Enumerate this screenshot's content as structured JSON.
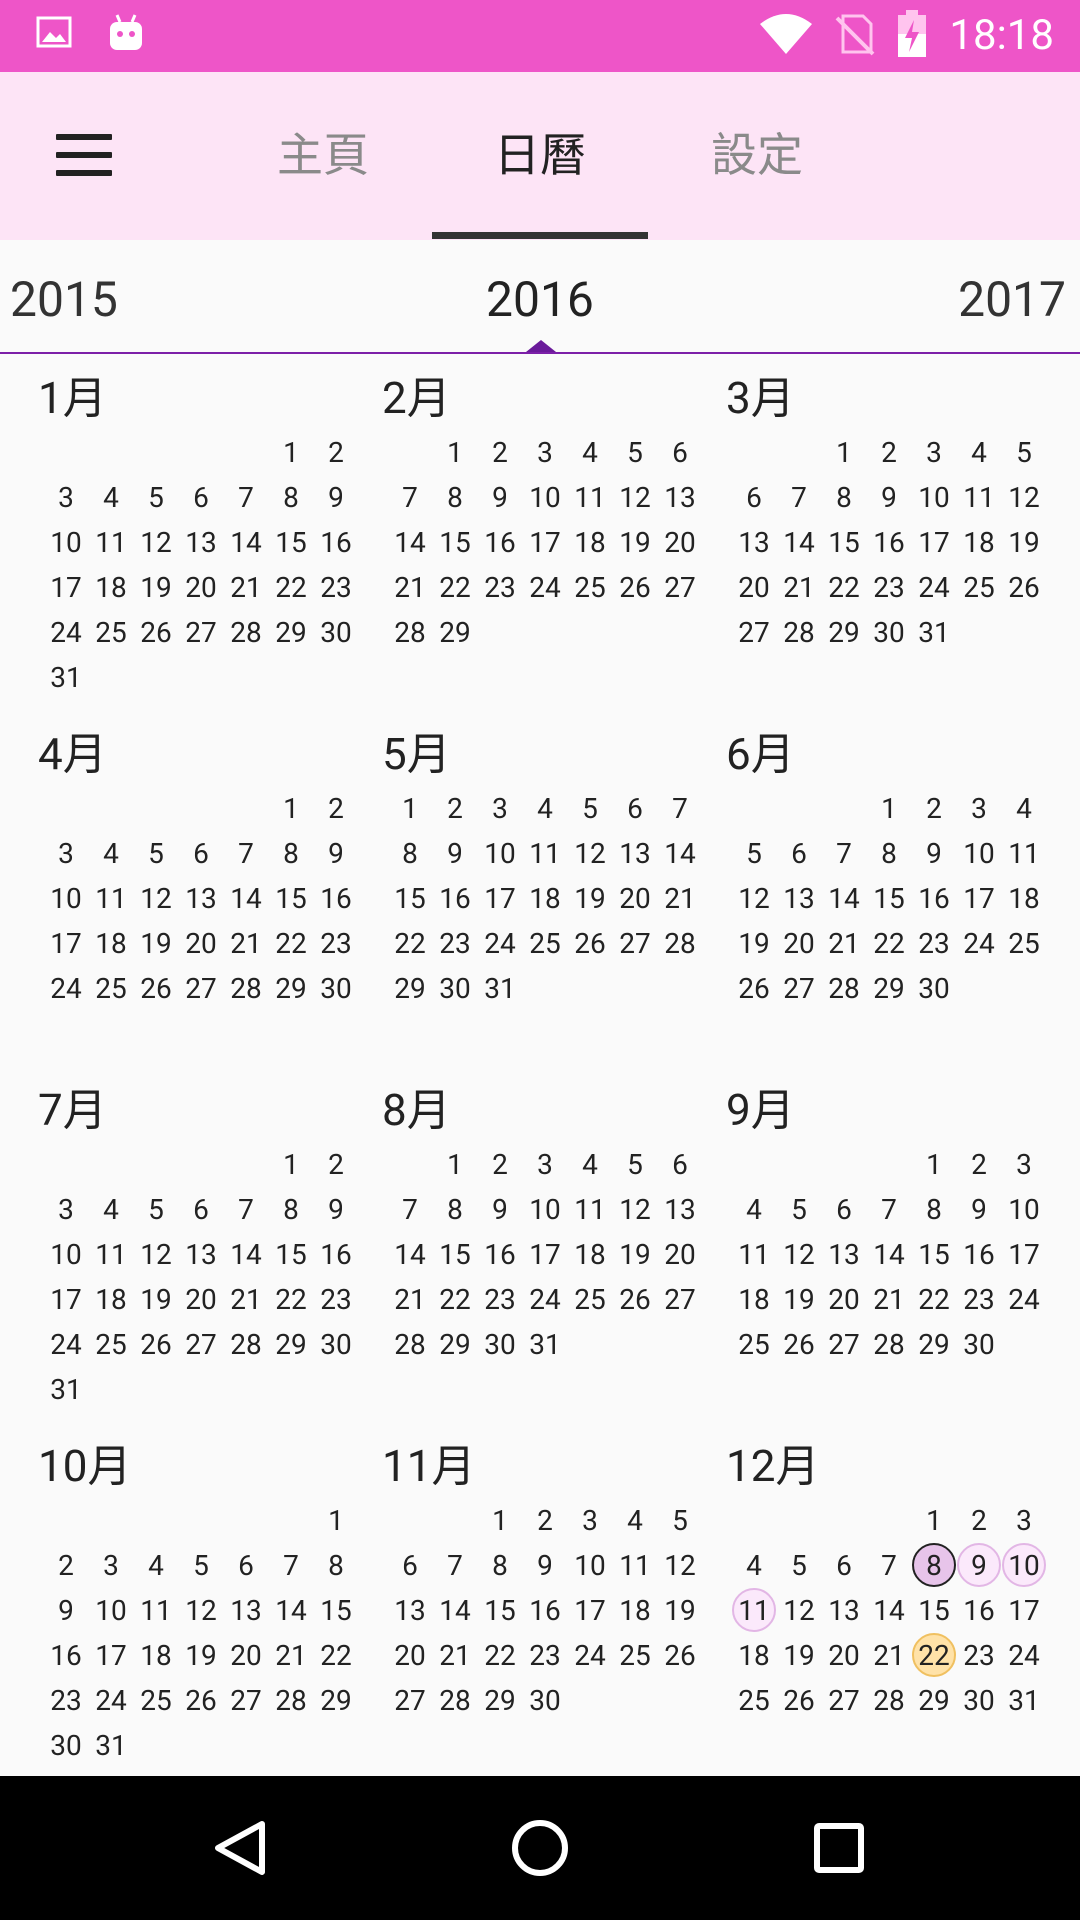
{
  "status_bar": {
    "time": "18:18",
    "icons_left": [
      "image-icon",
      "android-icon"
    ],
    "icons_right": [
      "wifi-icon",
      "no-sim-icon",
      "battery-charging-icon"
    ]
  },
  "app_bar": {
    "tabs": [
      {
        "label": "主頁",
        "selected": false
      },
      {
        "label": "日曆",
        "selected": true
      },
      {
        "label": "設定",
        "selected": false
      }
    ]
  },
  "year_picker": {
    "prev": "2015",
    "current": "2016",
    "next": "2017"
  },
  "months": [
    {
      "title": "1月",
      "offset": 5,
      "days": 31
    },
    {
      "title": "2月",
      "offset": 1,
      "days": 29
    },
    {
      "title": "3月",
      "offset": 2,
      "days": 31
    },
    {
      "title": "4月",
      "offset": 5,
      "days": 30
    },
    {
      "title": "5月",
      "offset": 0,
      "days": 31
    },
    {
      "title": "6月",
      "offset": 3,
      "days": 30
    },
    {
      "title": "7月",
      "offset": 5,
      "days": 31
    },
    {
      "title": "8月",
      "offset": 1,
      "days": 31
    },
    {
      "title": "9月",
      "offset": 4,
      "days": 30
    },
    {
      "title": "10月",
      "offset": 6,
      "days": 31
    },
    {
      "title": "11月",
      "offset": 2,
      "days": 30
    },
    {
      "title": "12月",
      "offset": 4,
      "days": 31,
      "today": 8,
      "marked": [
        9,
        10,
        11
      ],
      "event": [
        22
      ]
    }
  ],
  "colors": {
    "status_bar": "#ee55c8",
    "app_bar": "#fde4f6",
    "accent": "#7c1fa8",
    "today_fill": "#e7c4ea",
    "event_fill": "#ffe2a8"
  }
}
